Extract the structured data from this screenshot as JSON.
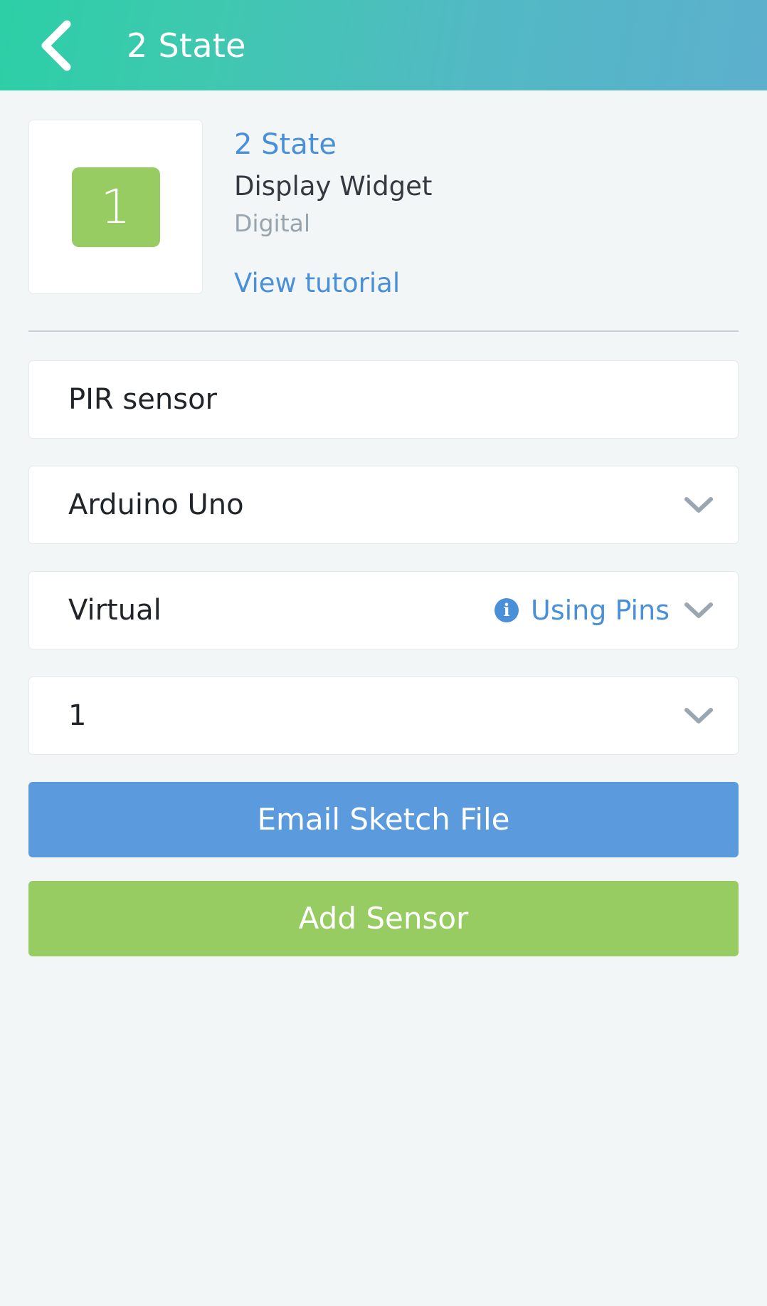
{
  "header": {
    "title": "2 State",
    "back_icon": "chevron-left-icon",
    "gradient_from": "#2ccfa6",
    "gradient_to": "#5cb0cd"
  },
  "widget": {
    "preview_value": "1",
    "preview_color": "#96cc62",
    "name": "2 State",
    "name_color": "#4a90d9",
    "type": "Display Widget",
    "kind": "Digital",
    "tutorial_label": "View tutorial"
  },
  "form": {
    "fields": [
      {
        "name_label": "sensor-name-input",
        "value": "PIR sensor",
        "has_chevron": false,
        "has_pins_note": false
      },
      {
        "name_label": "board-select",
        "value": "Arduino Uno",
        "has_chevron": true,
        "chevron_icon": "chevron-down-icon",
        "has_pins_note": false
      },
      {
        "name_label": "pin-type-select",
        "value": "Virtual",
        "has_chevron": true,
        "chevron_icon": "chevron-down-icon",
        "has_pins_note": true,
        "pins_info_icon": "info-icon",
        "pins_label": "Using Pins"
      },
      {
        "name_label": "pin-number-select",
        "value": "1",
        "has_chevron": true,
        "chevron_icon": "chevron-down-icon",
        "has_pins_note": false
      }
    ]
  },
  "buttons": {
    "email_sketch": "Email Sketch File",
    "email_sketch_color": "#5b9bdd",
    "add_sensor": "Add Sensor",
    "add_sensor_color": "#96cc62"
  }
}
